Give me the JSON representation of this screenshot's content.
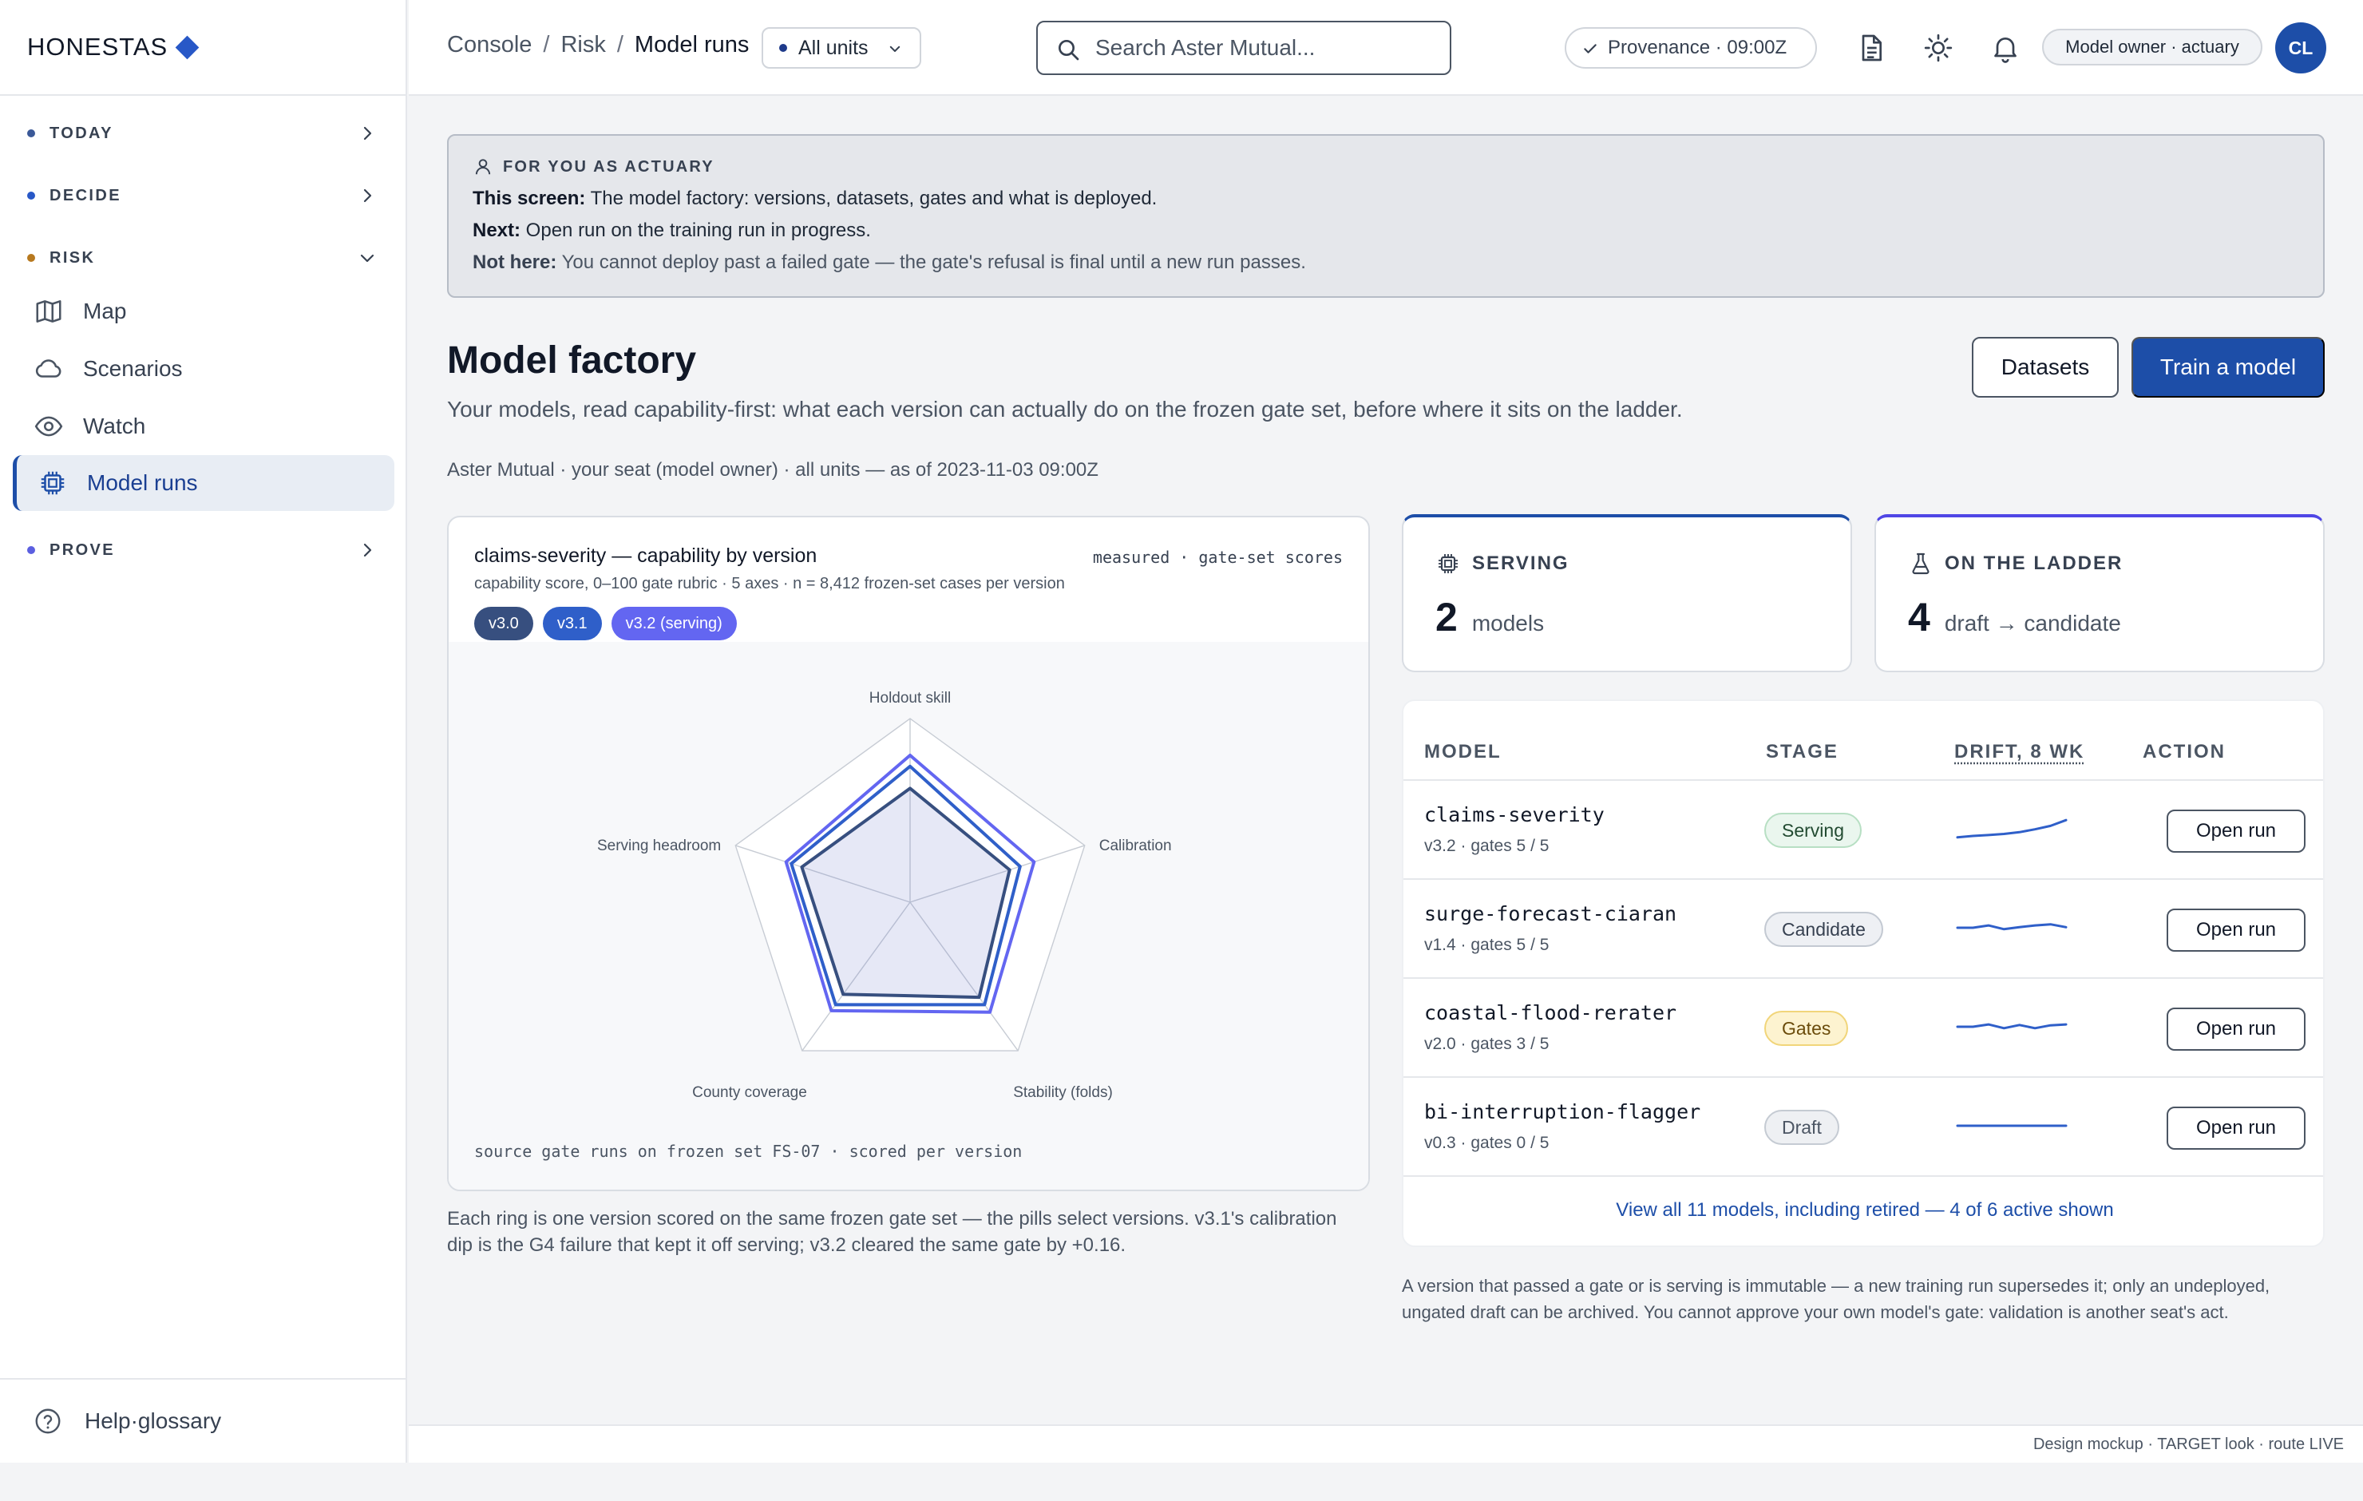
{
  "brand": {
    "name": "HONESTAS"
  },
  "nav": {
    "sections": {
      "today": "TODAY",
      "decide": "DECIDE",
      "risk": "RISK",
      "prove": "PROVE"
    },
    "risk_items": {
      "map": "Map",
      "scenarios": "Scenarios",
      "watch": "Watch",
      "model_runs": "Model runs"
    },
    "help": "Help·glossary"
  },
  "topbar": {
    "crumbs": [
      "Console",
      "Risk",
      "Model runs"
    ],
    "unit_select": "All units",
    "search_placeholder": "Search Aster Mutual...",
    "provenance": "Provenance · 09:00Z",
    "role": "Model owner · actuary",
    "avatar": "CL"
  },
  "hint": {
    "heading": "FOR YOU AS ACTUARY",
    "line1_label": "This screen:",
    "line1_text": " The model factory: versions, datasets, gates and what is deployed.",
    "line2_label": "Next:",
    "line2_text": " Open run on the training run in progress.",
    "line3_label": "Not here:",
    "line3_text": " You cannot deploy past a failed gate — the gate's refusal is final until a new run passes."
  },
  "page": {
    "title": "Model factory",
    "subtitle": "Your models, read capability-first: what each version can actually do on the frozen gate set, before where it sits on the ladder.",
    "meta": "Aster Mutual · your seat (model owner) · all units — as of 2023-11-03 09:00Z",
    "datasets_button": "Datasets",
    "train_button": "Train a model"
  },
  "radar": {
    "title": "claims-severity — capability by version",
    "tag": "measured · gate-set scores",
    "subtitle": "capability score, 0–100 gate rubric · 5 axes · n = 8,412 frozen-set cases per version",
    "pills": [
      "v3.0",
      "v3.1",
      "v3.2 (serving)"
    ],
    "source": "source gate runs on frozen set FS-07 · scored per version",
    "caption": "Each ring is one version scored on the same frozen gate set — the pills select versions. v3.1's calibration dip is the G4 failure that kept it off serving; v3.2 cleared the same gate by +0.16."
  },
  "chart_data": {
    "type": "radar",
    "axes": [
      "Holdout skill",
      "Calibration",
      "Stability (folds)",
      "County coverage",
      "Serving headroom"
    ],
    "range": [
      0,
      100
    ],
    "series": [
      {
        "name": "v3.0",
        "values": [
          62,
          57,
          64,
          62,
          62
        ],
        "color": "#374f7f"
      },
      {
        "name": "v3.1",
        "values": [
          74,
          63,
          69,
          69,
          68
        ],
        "color": "#2f5fc9"
      },
      {
        "name": "v3.2 (serving)",
        "values": [
          80,
          71,
          74,
          73,
          71
        ],
        "color": "#6366f1"
      }
    ]
  },
  "stats": {
    "serving_label": "SERVING",
    "serving_value": "2",
    "serving_unit": "models",
    "ladder_label": "ON THE LADDER",
    "ladder_value": "4",
    "ladder_unit": "draft → candidate"
  },
  "table": {
    "headers": [
      "MODEL",
      "STAGE",
      "DRIFT, 8 WK",
      "ACTION"
    ],
    "rows": [
      {
        "name": "claims-severity",
        "meta": "v3.2 · gates 5 / 5",
        "stage": "Serving",
        "stage_class": "serving",
        "drift": [
          0.2,
          0.25,
          0.28,
          0.32,
          0.38,
          0.48,
          0.6,
          0.8
        ],
        "action": "Open run"
      },
      {
        "name": "surge-forecast-ciaran",
        "meta": "v1.4 · gates 5 / 5",
        "stage": "Candidate",
        "stage_class": "candidate",
        "drift": [
          0.5,
          0.5,
          0.58,
          0.45,
          0.52,
          0.58,
          0.62,
          0.52
        ],
        "action": "Open run"
      },
      {
        "name": "coastal-flood-rerater",
        "meta": "v2.0 · gates 3 / 5",
        "stage": "Gates",
        "stage_class": "gates",
        "drift": [
          0.5,
          0.5,
          0.58,
          0.45,
          0.56,
          0.45,
          0.55,
          0.58
        ],
        "action": "Open run"
      },
      {
        "name": "bi-interruption-flagger",
        "meta": "v0.3 · gates 0 / 5",
        "stage": "Draft",
        "stage_class": "draft",
        "drift": [
          0.5,
          0.5,
          0.5,
          0.5,
          0.5,
          0.5,
          0.5,
          0.5
        ],
        "action": "Open run"
      }
    ],
    "view_all": "View all 11 models, including retired — 4 of 6 active shown",
    "note": "A version that passed a gate or is serving is immutable — a new training run supersedes it; only an undeployed, ungated draft can be archived. You cannot approve your own model's gate: validation is another seat's act."
  },
  "footer": "Design mockup · TARGET look · route LIVE",
  "colors": {
    "accent": "#1d4ea8",
    "today_dot": "#3b5998",
    "decide_dot": "#2858c7",
    "risk_dot": "#b7791f",
    "prove_dot": "#5b5fe0"
  }
}
